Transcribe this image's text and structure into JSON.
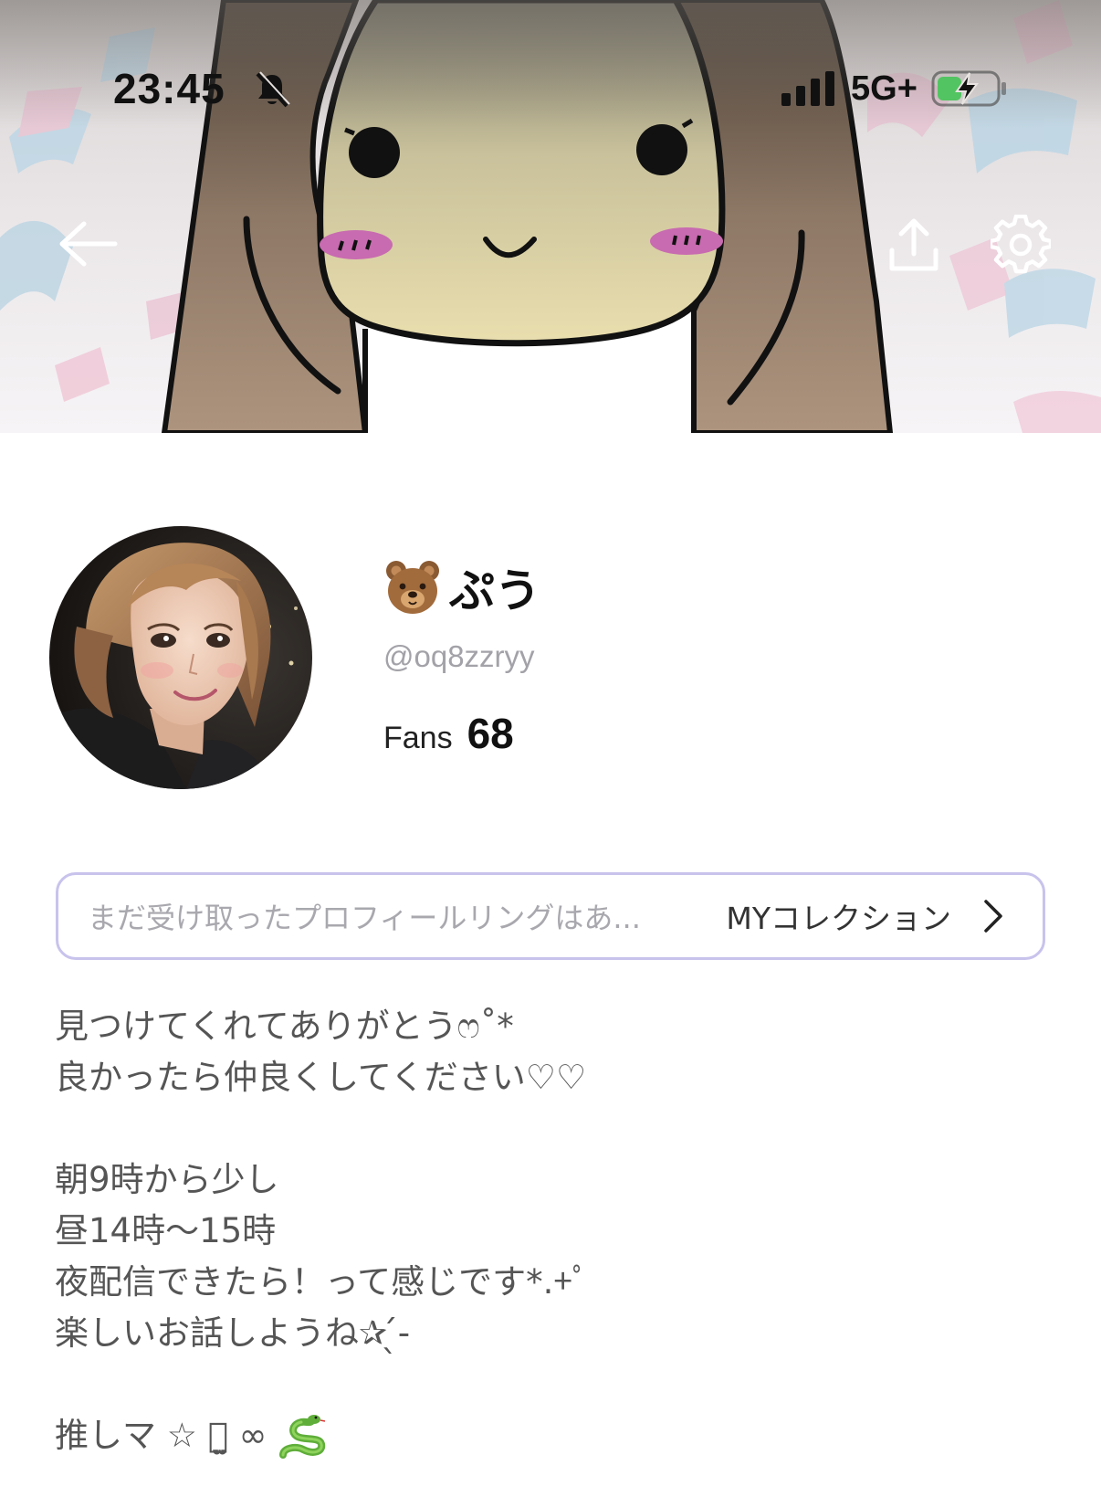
{
  "status_bar": {
    "time": "23:45",
    "network": "5G+",
    "icons": [
      "bell-slash-icon",
      "signal-icon",
      "battery-charging-icon"
    ]
  },
  "header": {
    "actions": [
      "back-arrow-icon",
      "share-icon",
      "gear-icon"
    ]
  },
  "profile": {
    "name": "ぷう",
    "name_emoji": "bear-face-icon",
    "handle": "@oq8zzryy",
    "fans_label": "Fans",
    "fans_count": "68"
  },
  "collection": {
    "status_text": "まだ受け取ったプロフィールリングはあ...",
    "link_label": "MYコレクション"
  },
  "bio": {
    "lines": [
      "見つけてくれてありがとうෆ˚*",
      "良かったら仲良くしてください♡♡",
      "",
      "朝9時から少し",
      "昼14時〜15時",
      "夜配信できたら！って感じです*.+ﾟ",
      "楽しいお話しようね✰ ̖́-",
      "",
      "推しマ ☆ ꪔ̤̫ ∞"
    ],
    "trailing_icon": "snake-icon"
  },
  "colors": {
    "accent_border": "#c8c3ec",
    "muted_text": "#a2a2a8",
    "body_text": "#555555"
  }
}
